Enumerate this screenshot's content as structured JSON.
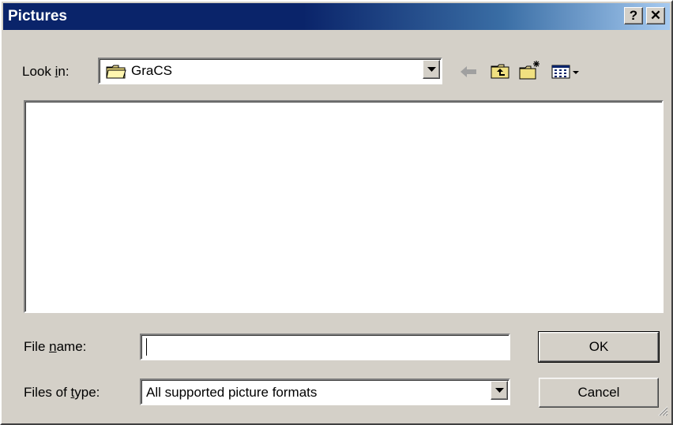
{
  "dialog": {
    "title": "Pictures",
    "help_glyph": "?",
    "close_glyph": "✕"
  },
  "look_in": {
    "label_prefix": "Look ",
    "label_underlined": "i",
    "label_suffix": "n:",
    "value": "GraCS",
    "value_icon": "folder-icon"
  },
  "toolbar": {
    "icons": [
      "back-arrow-icon",
      "up-one-level-icon",
      "create-new-folder-icon",
      "view-menu-icon"
    ]
  },
  "file_name": {
    "label_prefix": "File ",
    "label_underlined": "n",
    "label_suffix": "ame:",
    "value": ""
  },
  "file_type": {
    "label_prefix": "Files of ",
    "label_underlined": "t",
    "label_suffix": "ype:",
    "value": "All supported picture formats"
  },
  "buttons": {
    "ok": "OK",
    "cancel": "Cancel"
  },
  "colors": {
    "face": "#d4d0c8",
    "title_start": "#0a246a",
    "title_end": "#a6caf0"
  }
}
